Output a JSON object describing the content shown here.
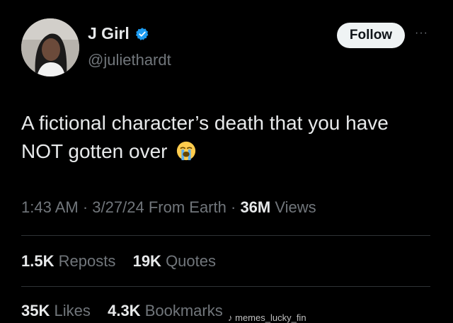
{
  "author": {
    "name": "J Girl",
    "handle": "@juliethardt",
    "verified": true
  },
  "follow_label": "Follow",
  "more_label": "···",
  "tweet": {
    "text": "A fictional character’s death that you have NOT gotten over",
    "emoji": "loudly-crying-face-icon"
  },
  "meta": {
    "time": "1:43 AM",
    "date": "3/27/24",
    "location": "From Earth",
    "views_count": "36M",
    "views_label": "Views"
  },
  "stats": {
    "reposts_count": "1.5K",
    "reposts_label": "Reposts",
    "quotes_count": "19K",
    "quotes_label": "Quotes",
    "likes_count": "35K",
    "likes_label": "Likes",
    "bookmarks_count": "4.3K",
    "bookmarks_label": "Bookmarks"
  },
  "watermark": "memes_lucky_fin",
  "colors": {
    "background": "#000000",
    "text_primary": "#e7e9ea",
    "text_secondary": "#71767b",
    "verified_blue": "#1d9bf0",
    "follow_button_bg": "#eff3f4"
  }
}
